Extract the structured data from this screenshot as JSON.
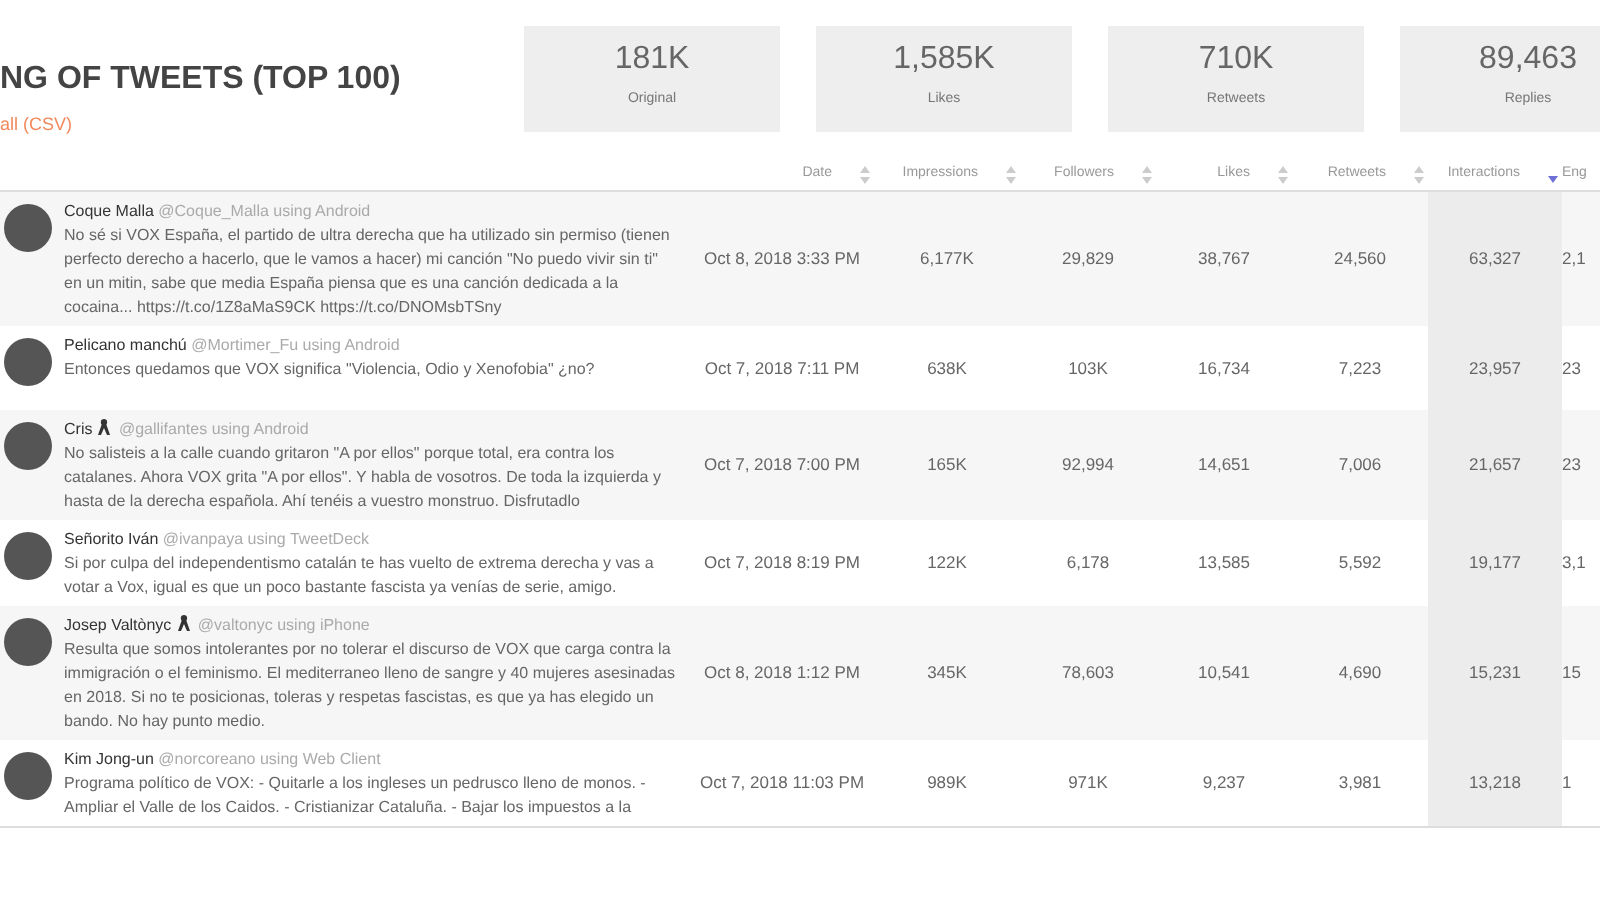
{
  "header": {
    "title": "NG OF TWEETS (TOP 100)",
    "download_link": "all (CSV)"
  },
  "stats": [
    {
      "value": "181K",
      "label": "Original"
    },
    {
      "value": "1,585K",
      "label": "Likes"
    },
    {
      "value": "710K",
      "label": "Retweets"
    },
    {
      "value": "89,463",
      "label": "Replies"
    }
  ],
  "table": {
    "columns": [
      {
        "label": "Date",
        "sorted": false
      },
      {
        "label": "Impressions",
        "sorted": false
      },
      {
        "label": "Followers",
        "sorted": false
      },
      {
        "label": "Likes",
        "sorted": false
      },
      {
        "label": "Retweets",
        "sorted": false
      },
      {
        "label": "Interactions",
        "sorted": true
      },
      {
        "label": "Eng"
      }
    ],
    "rows": [
      {
        "name": "Coque Malla",
        "ribbon": false,
        "handle": "@Coque_Malla using Android",
        "text": "No sé si VOX España, el partido de ultra derecha que ha utilizado sin permiso (tienen perfecto derecho a hacerlo, que le vamos a hacer) mi canción \"No puedo vivir sin ti\" en un mitin, sabe que media España piensa que es una canción dedicada a la cocaina... https://t.co/1Z8aMaS9CK https://t.co/DNOMsbTSny",
        "cells": [
          "Oct 8, 2018 3:33 PM",
          "6,177K",
          "29,829",
          "38,767",
          "24,560",
          "63,327",
          "2,1"
        ]
      },
      {
        "name": "Pelicano manchú",
        "ribbon": false,
        "handle": "@Mortimer_Fu using Android",
        "text": "Entonces quedamos que VOX significa \"Violencia, Odio y Xenofobia\" ¿no?",
        "cells": [
          "Oct 7, 2018 7:11 PM",
          "638K",
          "103K",
          "16,734",
          "7,223",
          "23,957",
          "23"
        ]
      },
      {
        "name": "Cris",
        "ribbon": true,
        "handle": "@gallifantes using Android",
        "text": "No salisteis a la calle cuando gritaron \"A por ellos\" porque total, era contra los catalanes. Ahora VOX grita \"A por ellos\". Y habla de vosotros. De toda la izquierda y hasta de la derecha española. Ahí tenéis a vuestro monstruo. Disfrutadlo",
        "cells": [
          "Oct 7, 2018 7:00 PM",
          "165K",
          "92,994",
          "14,651",
          "7,006",
          "21,657",
          "23"
        ]
      },
      {
        "name": "Señorito Iván",
        "ribbon": false,
        "handle": "@ivanpaya using TweetDeck",
        "text": "Si por culpa del independentismo catalán te has vuelto de extrema derecha y vas a votar a Vox, igual es que un poco bastante fascista ya venías de serie, amigo.",
        "cells": [
          "Oct 7, 2018 8:19 PM",
          "122K",
          "6,178",
          "13,585",
          "5,592",
          "19,177",
          "3,1"
        ]
      },
      {
        "name": "Josep Valtònyc",
        "ribbon": true,
        "handle": "@valtonyc using iPhone",
        "text": "Resulta que somos intolerantes por no tolerar el discurso de VOX que carga contra la immigración o el feminismo. El mediterraneo lleno de sangre y 40 mujeres asesinadas en 2018. Si no te posicionas, toleras y respetas fascistas, es que ya has elegido un bando. No hay punto medio.",
        "cells": [
          "Oct 8, 2018 1:12 PM",
          "345K",
          "78,603",
          "10,541",
          "4,690",
          "15,231",
          "15"
        ]
      },
      {
        "name": "Kim Jong-un",
        "ribbon": false,
        "handle": "@norcoreano using Web Client",
        "text": "Programa político de VOX: - Quitarle a los ingleses un pedrusco lleno de monos. - Ampliar el Valle de los Caidos. - Cristianizar Cataluña. - Bajar los impuestos a la",
        "cells": [
          "Oct 7, 2018 11:03 PM",
          "989K",
          "971K",
          "9,237",
          "3,981",
          "13,218",
          "1"
        ]
      }
    ]
  }
}
